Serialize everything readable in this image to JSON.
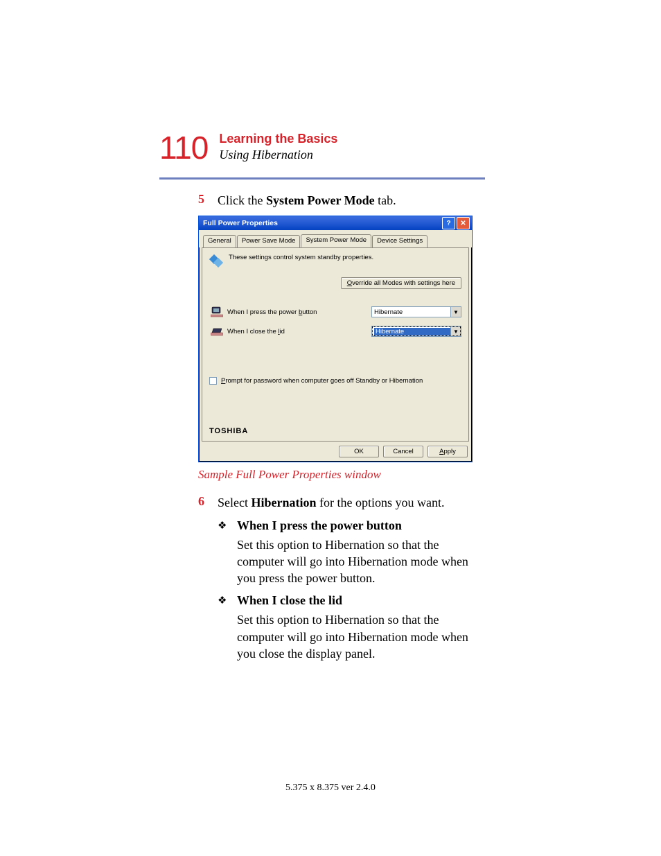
{
  "page_number": "110",
  "chapter_title": "Learning the Basics",
  "section_title": "Using Hibernation",
  "steps": {
    "s5": {
      "num": "5",
      "pre": "Click the ",
      "bold": "System Power Mode",
      "post": " tab."
    },
    "s6": {
      "num": "6",
      "pre": "Select ",
      "bold": "Hibernation",
      "post": " for the options you want."
    }
  },
  "caption": "Sample Full Power Properties window",
  "bullets": {
    "b1": {
      "head": "When I press the power button",
      "body": "Set this option to Hibernation so that the computer will go into Hibernation mode when you press the power button."
    },
    "b2": {
      "head": "When I close the lid",
      "body": "Set this option to Hibernation so that the computer will go into Hibernation mode when you close the display panel."
    }
  },
  "dialog": {
    "title": "Full Power Properties",
    "tabs": [
      "General",
      "Power Save Mode",
      "System Power Mode",
      "Device Settings"
    ],
    "info": "These settings control system standby properties.",
    "override_pre": "O",
    "override": "verride all Modes with settings here",
    "row1_pre": "When I press the power ",
    "row1_u": "b",
    "row1_post": "utton",
    "row1_value": "Hibernate",
    "row2_pre": "When I close the ",
    "row2_u": "l",
    "row2_post": "id",
    "row2_value": "Hibernate",
    "checkbox_u": "P",
    "checkbox": "rompt for password when computer goes off Standby or Hibernation",
    "brand": "TOSHIBA",
    "ok": "OK",
    "cancel": "Cancel",
    "apply_u": "A",
    "apply": "pply"
  },
  "footer": "5.375 x 8.375 ver 2.4.0"
}
